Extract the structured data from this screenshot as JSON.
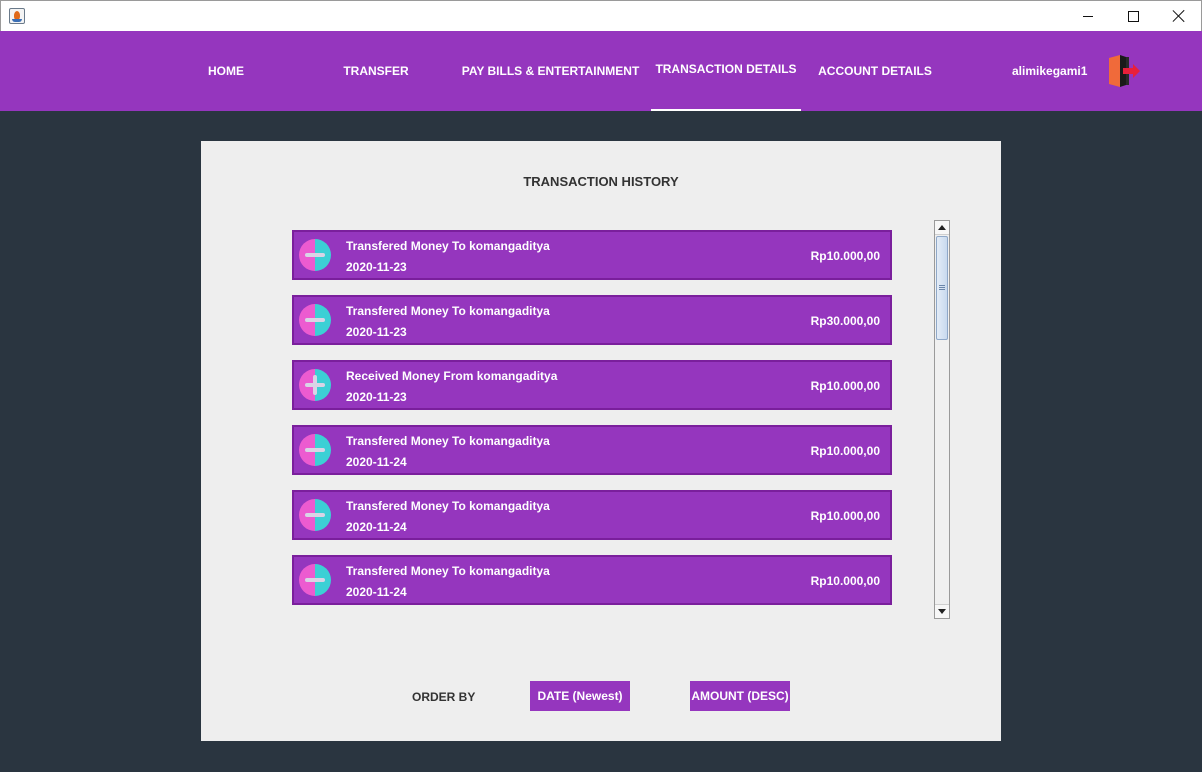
{
  "window": {
    "controls": [
      "minimize",
      "maximize",
      "close"
    ]
  },
  "nav": {
    "items": [
      {
        "label": "HOME"
      },
      {
        "label": "TRANSFER"
      },
      {
        "label": "PAY BILLS & ENTERTAINMENT"
      },
      {
        "label": "TRANSACTION DETAILS",
        "active": true
      },
      {
        "label": "ACCOUNT DETAILS"
      }
    ],
    "username": "alimikegami1",
    "logout_icon": "logout-door-icon"
  },
  "panel": {
    "title": "TRANSACTION HISTORY"
  },
  "transactions": [
    {
      "type": "minus",
      "description": "Transfered Money To komangaditya",
      "date": "2020-11-23",
      "amount": "Rp10.000,00"
    },
    {
      "type": "minus",
      "description": "Transfered Money To komangaditya",
      "date": "2020-11-23",
      "amount": "Rp30.000,00"
    },
    {
      "type": "plus",
      "description": "Received Money From komangaditya",
      "date": "2020-11-23",
      "amount": "Rp10.000,00"
    },
    {
      "type": "minus",
      "description": "Transfered Money To komangaditya",
      "date": "2020-11-24",
      "amount": "Rp10.000,00"
    },
    {
      "type": "minus",
      "description": "Transfered Money To komangaditya",
      "date": "2020-11-24",
      "amount": "Rp10.000,00"
    },
    {
      "type": "minus",
      "description": "Transfered Money To komangaditya",
      "date": "2020-11-24",
      "amount": "Rp10.000,00"
    }
  ],
  "order": {
    "label": "ORDER BY",
    "date_button": "DATE (Newest)",
    "amount_button": "AMOUNT (DESC)"
  },
  "colors": {
    "accent": "#9536be",
    "background": "#2a3540",
    "panel": "#eeeeee"
  }
}
